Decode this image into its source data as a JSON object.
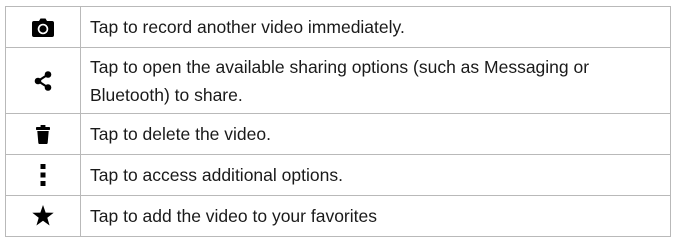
{
  "rows": [
    {
      "icon": "camera-icon",
      "text": "Tap to record another video immediately."
    },
    {
      "icon": "share-icon",
      "text": "Tap to open the available sharing options (such as Messaging or Bluetooth) to share."
    },
    {
      "icon": "trash-icon",
      "text": "Tap to delete the video."
    },
    {
      "icon": "more-options-icon",
      "text": "Tap to access additional options."
    },
    {
      "icon": "star-icon",
      "text": "Tap to add the video to your favorites"
    }
  ],
  "colors": {
    "icon": "#000000",
    "border": "#b9b9b9",
    "text": "#1a1a1a"
  }
}
